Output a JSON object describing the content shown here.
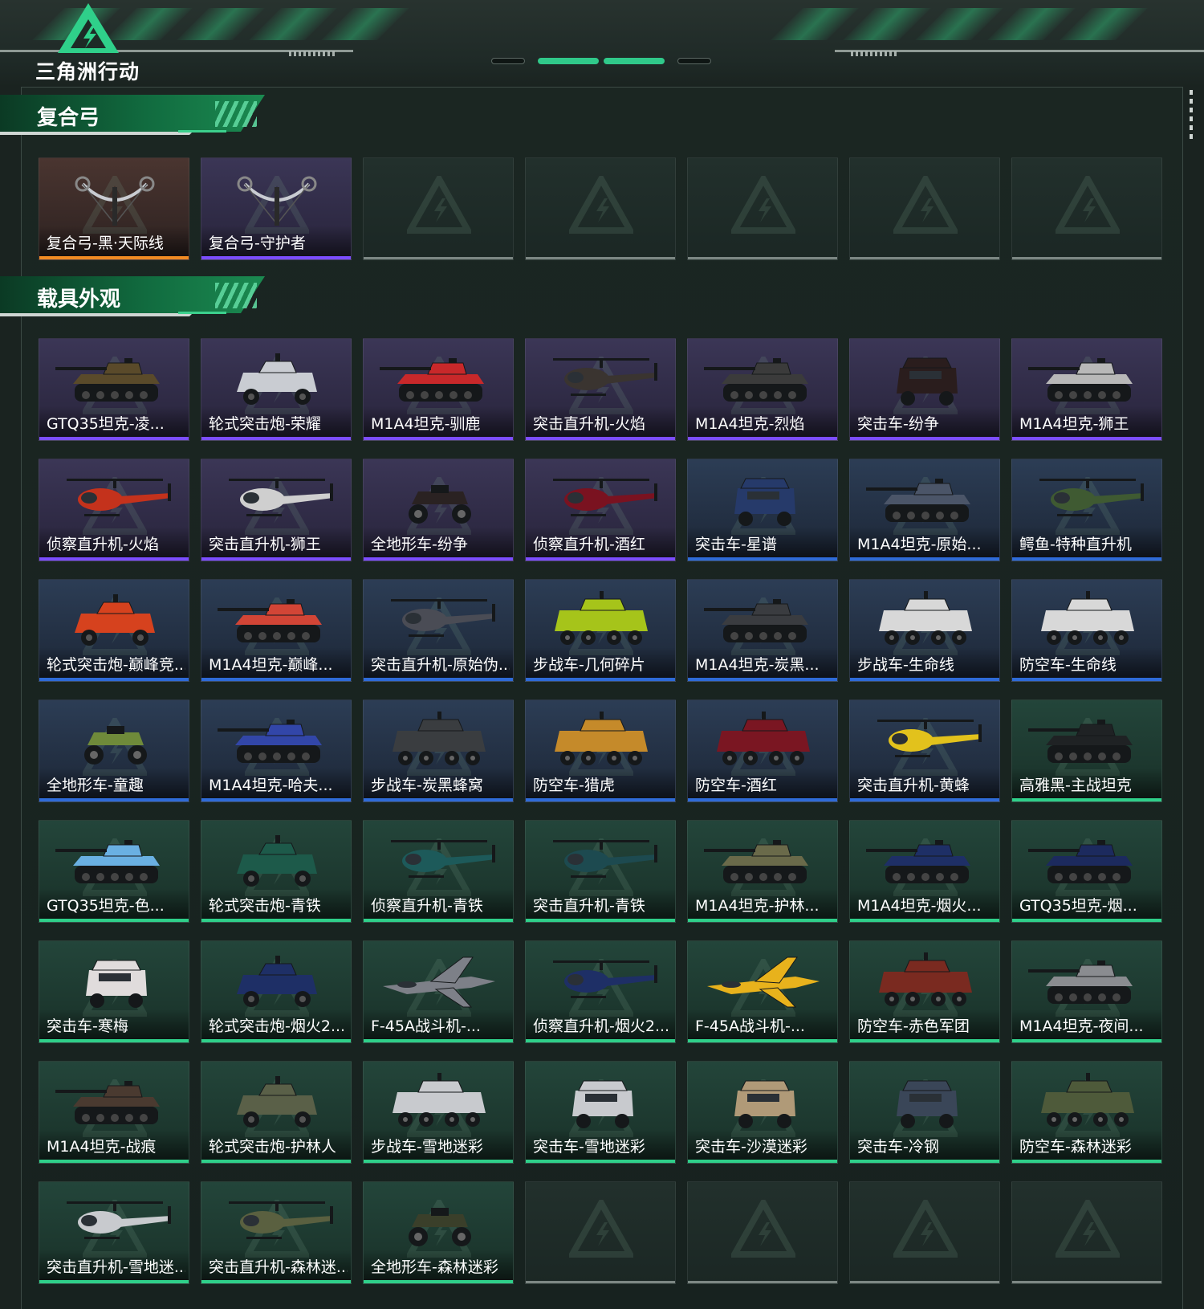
{
  "brand": {
    "logo_text": "三角洲行动",
    "accent": "#2fd08a"
  },
  "rarity_colors": {
    "purple": "#7c4dff",
    "blue": "#2f6bd8",
    "green": "#2fd08a",
    "orange": "#f08a23",
    "empty": "#7c8783"
  },
  "sections": [
    {
      "title": "复合弓",
      "items": [
        {
          "name": "复合弓-黑·天际线",
          "rarity": "orange",
          "kind": "bow"
        },
        {
          "name": "复合弓-守护者",
          "rarity": "purple",
          "kind": "bow"
        },
        {
          "name": "",
          "rarity": "empty",
          "kind": "empty"
        },
        {
          "name": "",
          "rarity": "empty",
          "kind": "empty"
        },
        {
          "name": "",
          "rarity": "empty",
          "kind": "empty"
        },
        {
          "name": "",
          "rarity": "empty",
          "kind": "empty"
        },
        {
          "name": "",
          "rarity": "empty",
          "kind": "empty"
        }
      ]
    },
    {
      "title": "载具外观",
      "items": [
        {
          "name": "GTQ35坦克-凌...",
          "rarity": "purple",
          "kind": "tank",
          "color": "#5a4a2a"
        },
        {
          "name": "轮式突击炮-荣耀",
          "rarity": "purple",
          "kind": "apc4",
          "color": "#c9ccd2"
        },
        {
          "name": "M1A4坦克-驯鹿",
          "rarity": "purple",
          "kind": "tank",
          "color": "#c8282a"
        },
        {
          "name": "突击直升机-火焰",
          "rarity": "purple",
          "kind": "heli",
          "color": "#3a3430"
        },
        {
          "name": "M1A4坦克-烈焰",
          "rarity": "purple",
          "kind": "tank",
          "color": "#3b3b3b"
        },
        {
          "name": "突击车-纷争",
          "rarity": "purple",
          "kind": "truck",
          "color": "#2a1d1d"
        },
        {
          "name": "M1A4坦克-狮王",
          "rarity": "purple",
          "kind": "tank",
          "color": "#b8b8b8"
        },
        {
          "name": "侦察直升机-火焰",
          "rarity": "purple",
          "kind": "heli",
          "color": "#c4321c"
        },
        {
          "name": "突击直升机-狮王",
          "rarity": "purple",
          "kind": "heli",
          "color": "#cfcfcf"
        },
        {
          "name": "全地形车-纷争",
          "rarity": "purple",
          "kind": "atv",
          "color": "#2a2222"
        },
        {
          "name": "侦察直升机-酒红",
          "rarity": "purple",
          "kind": "heli",
          "color": "#7a1220"
        },
        {
          "name": "突击车-星谱",
          "rarity": "blue",
          "kind": "truck",
          "color": "#263a6a"
        },
        {
          "name": "M1A4坦克-原始...",
          "rarity": "blue",
          "kind": "tank",
          "color": "#4b5568"
        },
        {
          "name": "鳄鱼-特种直升机",
          "rarity": "blue",
          "kind": "heli",
          "color": "#3f5a32"
        },
        {
          "name": "轮式突击炮-巅峰竞...",
          "rarity": "blue",
          "kind": "apc4",
          "color": "#d6421e"
        },
        {
          "name": "M1A4坦克-巅峰...",
          "rarity": "blue",
          "kind": "tank",
          "color": "#d24536"
        },
        {
          "name": "突击直升机-原始伪...",
          "rarity": "blue",
          "kind": "heli",
          "color": "#4a4c55"
        },
        {
          "name": "步战车-几何碎片",
          "rarity": "blue",
          "kind": "apc8",
          "color": "#a6c41a"
        },
        {
          "name": "M1A4坦克-炭黑...",
          "rarity": "blue",
          "kind": "tank",
          "color": "#3a3c40"
        },
        {
          "name": "步战车-生命线",
          "rarity": "blue",
          "kind": "apc8",
          "color": "#d8d8d8"
        },
        {
          "name": "防空车-生命线",
          "rarity": "blue",
          "kind": "apc8",
          "color": "#d8d8d8"
        },
        {
          "name": "全地形车-童趣",
          "rarity": "blue",
          "kind": "atv",
          "color": "#6f8a3a"
        },
        {
          "name": "M1A4坦克-哈夫...",
          "rarity": "blue",
          "kind": "tank",
          "color": "#3246a8"
        },
        {
          "name": "步战车-炭黑蜂窝",
          "rarity": "blue",
          "kind": "apc8",
          "color": "#3a3d40"
        },
        {
          "name": "防空车-猎虎",
          "rarity": "blue",
          "kind": "apc8",
          "color": "#c58a2a"
        },
        {
          "name": "防空车-酒红",
          "rarity": "blue",
          "kind": "apc8",
          "color": "#7a1622"
        },
        {
          "name": "突击直升机-黄蜂",
          "rarity": "blue",
          "kind": "heli",
          "color": "#e2c21c"
        },
        {
          "name": "高雅黑-主战坦克",
          "rarity": "green",
          "kind": "tank",
          "color": "#1f2224"
        },
        {
          "name": "GTQ35坦克-色...",
          "rarity": "green",
          "kind": "tank",
          "color": "#6ab0e2"
        },
        {
          "name": "轮式突击炮-青铁",
          "rarity": "green",
          "kind": "apc4",
          "color": "#1d5a4a"
        },
        {
          "name": "侦察直升机-青铁",
          "rarity": "green",
          "kind": "heli",
          "color": "#1d5a5a"
        },
        {
          "name": "突击直升机-青铁",
          "rarity": "green",
          "kind": "heli",
          "color": "#1d4a50"
        },
        {
          "name": "M1A4坦克-护林...",
          "rarity": "green",
          "kind": "tank",
          "color": "#6a6a4a"
        },
        {
          "name": "M1A4坦克-烟火...",
          "rarity": "green",
          "kind": "tank",
          "color": "#1e2f66"
        },
        {
          "name": "GTQ35坦克-烟...",
          "rarity": "green",
          "kind": "tank",
          "color": "#1c2a5e"
        },
        {
          "name": "突击车-寒梅",
          "rarity": "green",
          "kind": "truck",
          "color": "#e0dcdc"
        },
        {
          "name": "轮式突击炮-烟火2...",
          "rarity": "green",
          "kind": "apc4",
          "color": "#1e2f66"
        },
        {
          "name": "F-45A战斗机-...",
          "rarity": "green",
          "kind": "jet",
          "color": "#7d8088"
        },
        {
          "name": "侦察直升机-烟火2...",
          "rarity": "green",
          "kind": "heli",
          "color": "#1e2f66"
        },
        {
          "name": "F-45A战斗机-...",
          "rarity": "green",
          "kind": "jet",
          "color": "#e8b21c"
        },
        {
          "name": "防空车-赤色军团",
          "rarity": "green",
          "kind": "apc8",
          "color": "#7a2a20"
        },
        {
          "name": "M1A4坦克-夜间...",
          "rarity": "green",
          "kind": "tank",
          "color": "#8a8c90"
        },
        {
          "name": "M1A4坦克-战痕",
          "rarity": "green",
          "kind": "tank",
          "color": "#4a3a30"
        },
        {
          "name": "轮式突击炮-护林人",
          "rarity": "green",
          "kind": "apc4",
          "color": "#5a6048"
        },
        {
          "name": "步战车-雪地迷彩",
          "rarity": "green",
          "kind": "apc8",
          "color": "#c8cace"
        },
        {
          "name": "突击车-雪地迷彩",
          "rarity": "green",
          "kind": "truck",
          "color": "#c8cace"
        },
        {
          "name": "突击车-沙漠迷彩",
          "rarity": "green",
          "kind": "truck",
          "color": "#b09a78"
        },
        {
          "name": "突击车-冷钢",
          "rarity": "green",
          "kind": "truck",
          "color": "#3a4658"
        },
        {
          "name": "防空车-森林迷彩",
          "rarity": "green",
          "kind": "apc8",
          "color": "#4e5a3a"
        },
        {
          "name": "突击直升机-雪地迷...",
          "rarity": "green",
          "kind": "heli",
          "color": "#c8cace"
        },
        {
          "name": "突击直升机-森林迷...",
          "rarity": "green",
          "kind": "heli",
          "color": "#5a6040"
        },
        {
          "name": "全地形车-森林迷彩",
          "rarity": "green",
          "kind": "atv",
          "color": "#3a3f2a"
        },
        {
          "name": "",
          "rarity": "empty",
          "kind": "empty"
        },
        {
          "name": "",
          "rarity": "empty",
          "kind": "empty"
        },
        {
          "name": "",
          "rarity": "empty",
          "kind": "empty"
        },
        {
          "name": "",
          "rarity": "empty",
          "kind": "empty"
        }
      ]
    }
  ]
}
